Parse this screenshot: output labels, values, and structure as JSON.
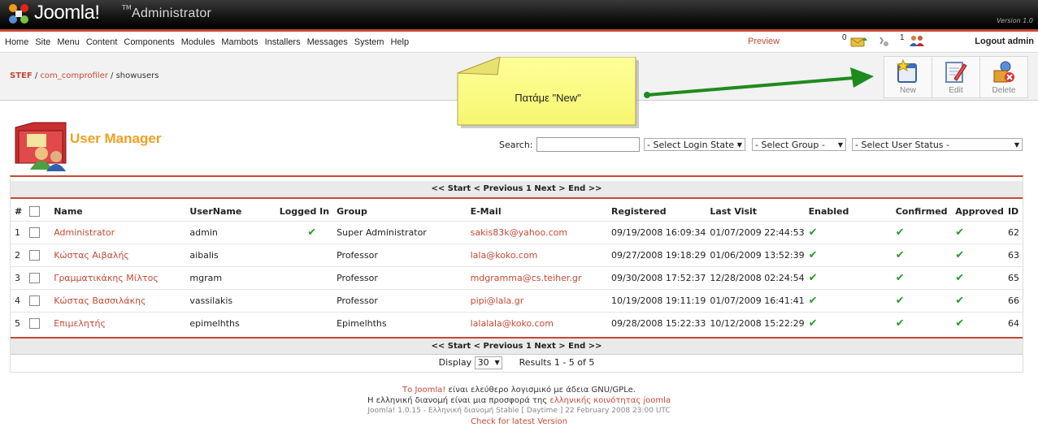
{
  "header": {
    "logo_text": "Joomla!",
    "logo_tm": "TM",
    "subtitle": "Administrator",
    "version": "Version 1.0"
  },
  "menu": {
    "items": [
      "Home",
      "Site",
      "Menu",
      "Content",
      "Components",
      "Modules",
      "Mambots",
      "Installers",
      "Messages",
      "System",
      "Help"
    ],
    "preview": "Preview",
    "messages_count": "0",
    "users_online": "1",
    "logout": "Logout admin"
  },
  "breadcrumb": {
    "site": "STEF",
    "component": "com_comprofiler",
    "task": "/ showusers"
  },
  "toolbar": {
    "new_label": "New",
    "edit_label": "Edit",
    "delete_label": "Delete"
  },
  "callout": {
    "text": "Πατάμε \"New\""
  },
  "manager": {
    "title": "User Manager",
    "search_label": "Search:",
    "search_value": "",
    "login_state": "- Select Login State -",
    "group": "- Select Group -",
    "user_status": "- Select User Status -"
  },
  "pagination": {
    "nav": "<< Start < Previous 1 Next > End >>",
    "display_label": "Display",
    "display_value": "30",
    "results": "Results 1 - 5 of 5"
  },
  "table": {
    "headers": [
      "#",
      "",
      "Name",
      "UserName",
      "Logged In",
      "Group",
      "E-Mail",
      "Registered",
      "Last Visit",
      "Enabled",
      "Confirmed",
      "Approved",
      "ID"
    ],
    "rows": [
      {
        "n": "1",
        "name": "Administrator",
        "username": "admin",
        "logged_in": true,
        "group": "Super Administrator",
        "email": "sakis83k@yahoo.com",
        "registered": "09/19/2008 16:09:34",
        "last_visit": "01/07/2009 22:44:53",
        "id": "62"
      },
      {
        "n": "2",
        "name": "Κώστας Αιβαλής",
        "username": "aibalis",
        "logged_in": false,
        "group": "Professor",
        "email": "lala@koko.com",
        "registered": "09/27/2008 19:18:29",
        "last_visit": "01/06/2009 13:52:39",
        "id": "63"
      },
      {
        "n": "3",
        "name": "Γραμματικάκης Μίλτος",
        "username": "mgram",
        "logged_in": false,
        "group": "Professor",
        "email": "mdgramma@cs.teiher.gr",
        "registered": "09/30/2008 17:52:37",
        "last_visit": "12/28/2008 02:24:54",
        "id": "65"
      },
      {
        "n": "4",
        "name": "Κώστας Βασσιλάκης",
        "username": "vassilakis",
        "logged_in": false,
        "group": "Professor",
        "email": "pipi@lala.gr",
        "registered": "10/19/2008 19:11:19",
        "last_visit": "01/07/2009 16:41:41",
        "id": "66"
      },
      {
        "n": "5",
        "name": "Επιμελητής",
        "username": "epimelhths",
        "logged_in": false,
        "group": "Epimelhths",
        "email": "lalalala@koko.com",
        "registered": "09/28/2008 15:22:33",
        "last_visit": "10/12/2008 15:22:29",
        "id": "64"
      }
    ]
  },
  "footer": {
    "line1_link": "Το Joomla!",
    "line1_text": " είναι ελεύθερο λογισμικό με άδεια GNU/GPLe.",
    "line2_text": "Η ελληνική διανομή είναι μια προσφορά της ",
    "line2_link": "ελληνικής κοινότητας joomla",
    "line3": "Joomla! 1.0.15 - Ελληνική διανομή Stable [ Daytime ] 22 February 2008 23:00 UTC",
    "line4": "Check for latest Version"
  },
  "colors": {
    "accent": "#c64934",
    "title": "#f0a020",
    "check": "#2a9a2a",
    "callout": "#ffff80"
  }
}
